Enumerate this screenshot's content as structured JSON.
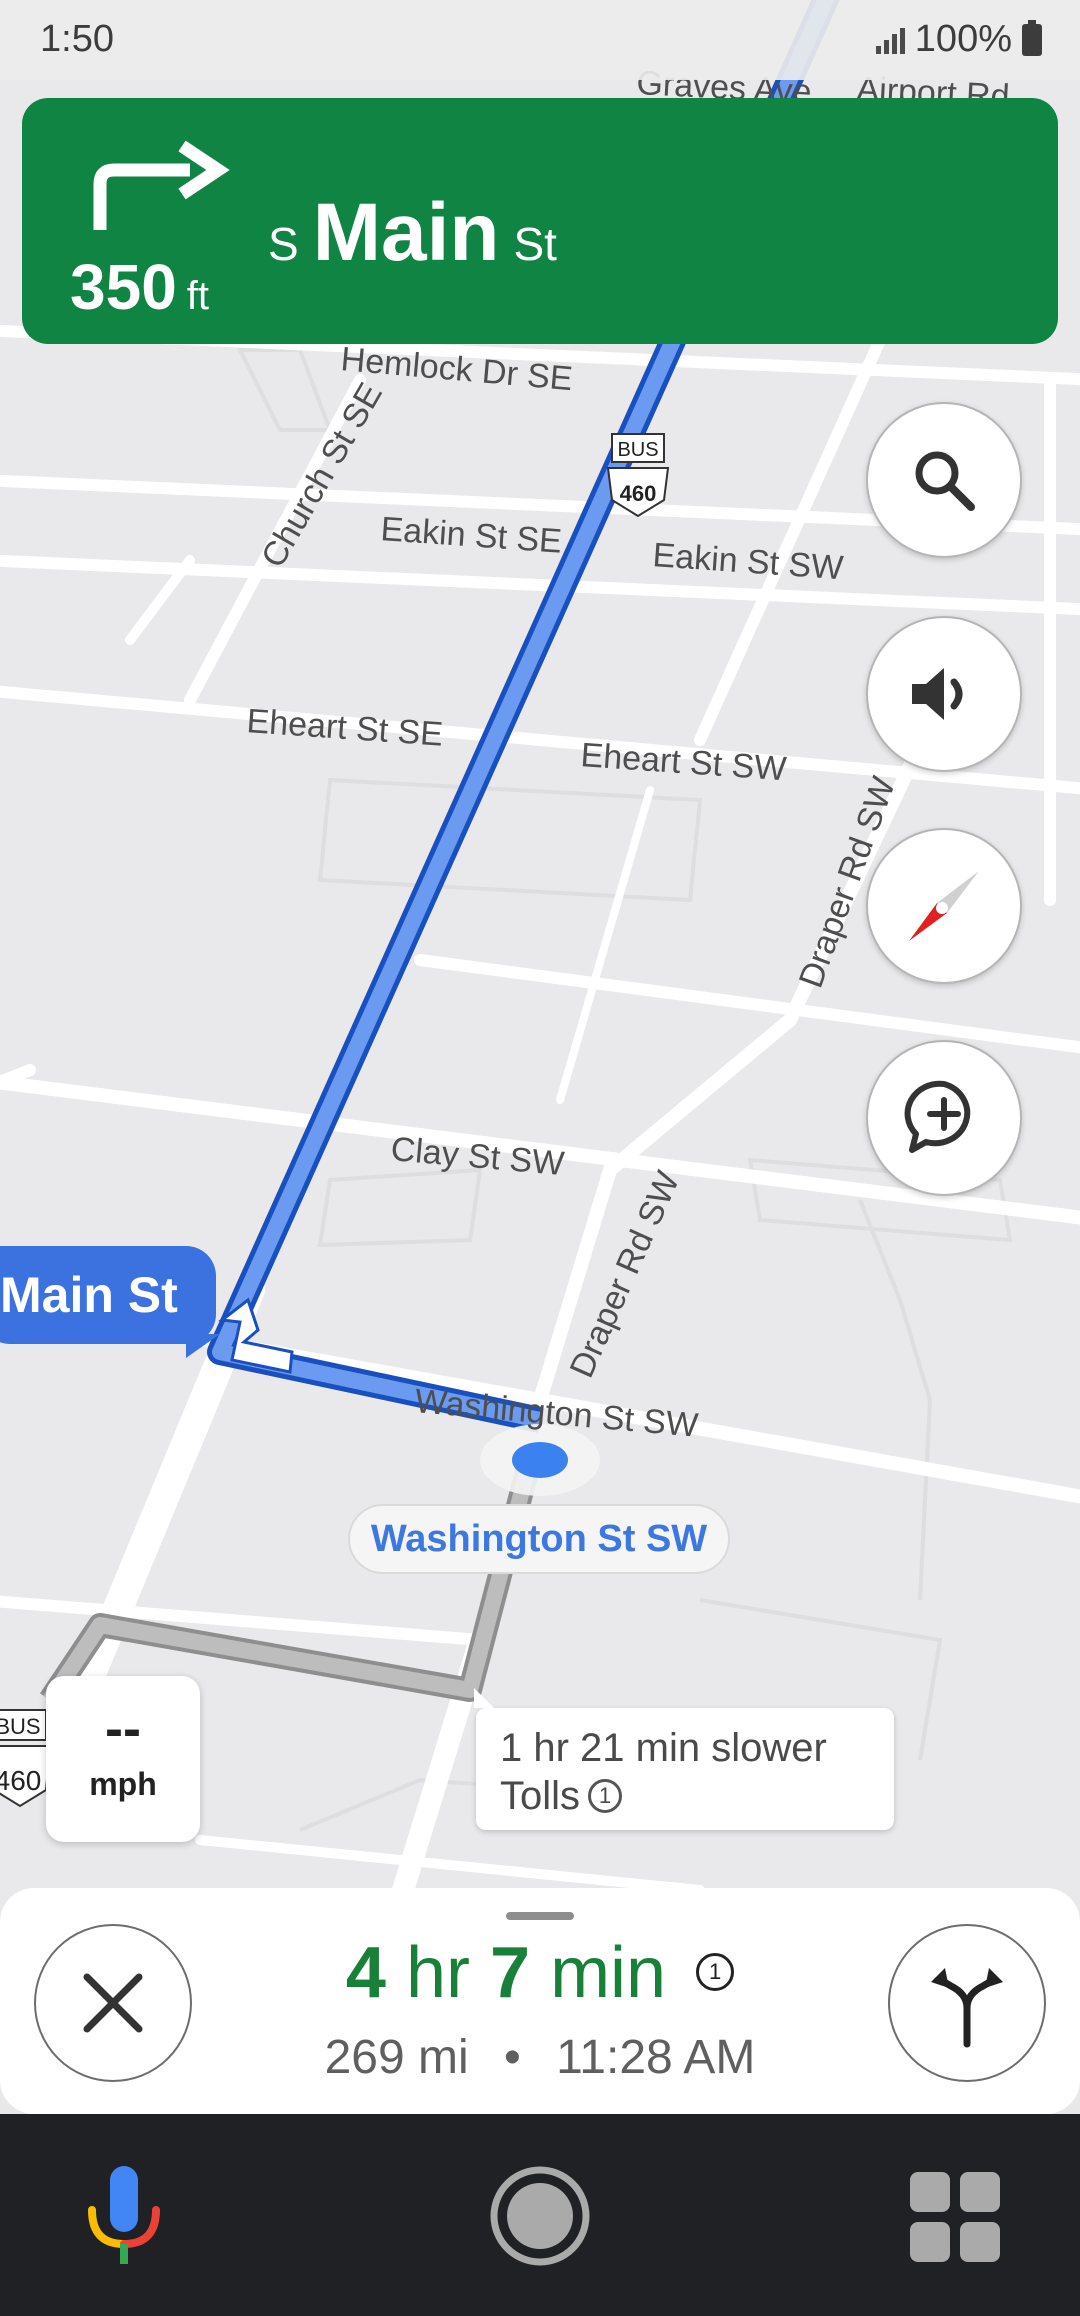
{
  "status_bar": {
    "time": "1:50",
    "battery": "100%"
  },
  "instruction": {
    "distance_value": "350",
    "distance_unit": "ft",
    "street_prefix": "S",
    "street_main": "Main",
    "street_suffix": "St"
  },
  "map": {
    "labels": {
      "graves_ave": "Graves Ave",
      "airport_rd": "Airport Rd",
      "hemlock": "Hemlock Dr SE",
      "church": "Church St SE",
      "eakin_se": "Eakin St SE",
      "eakin_sw": "Eakin St SW",
      "eheart_se": "Eheart St SE",
      "eheart_sw": "Eheart St SW",
      "draper_top": "Draper Rd SW",
      "draper_mid": "Draper Rd SW",
      "clay": "Clay St SW",
      "washington": "Washington St SW",
      "bus_sign": "BUS",
      "route_460": "460"
    },
    "next_street_pill": "Main St",
    "current_location_label": "Washington St SW",
    "alternate_route": {
      "line1": "1 hr 21 min slower",
      "line2": "Tolls",
      "info_mark": "1"
    }
  },
  "speed": {
    "value": "--",
    "unit": "mph"
  },
  "trip": {
    "hours": "4",
    "hours_unit": "hr",
    "minutes": "7",
    "minutes_unit": "min",
    "info_mark": "1",
    "distance": "269 mi",
    "separator": "•",
    "arrival": "11:28 AM"
  },
  "icons": {
    "search": "search-icon",
    "sound": "volume-icon",
    "compass": "compass-icon",
    "report": "add-comment-icon",
    "close": "close-icon",
    "alternates": "alt-routes-icon",
    "mic": "mic-icon",
    "home": "home-icon",
    "apps": "apps-grid-icon"
  },
  "colors": {
    "banner": "#0f8443",
    "route": "#3b72e0",
    "eta": "#188038",
    "alternate_route": "#a8a8a8"
  }
}
